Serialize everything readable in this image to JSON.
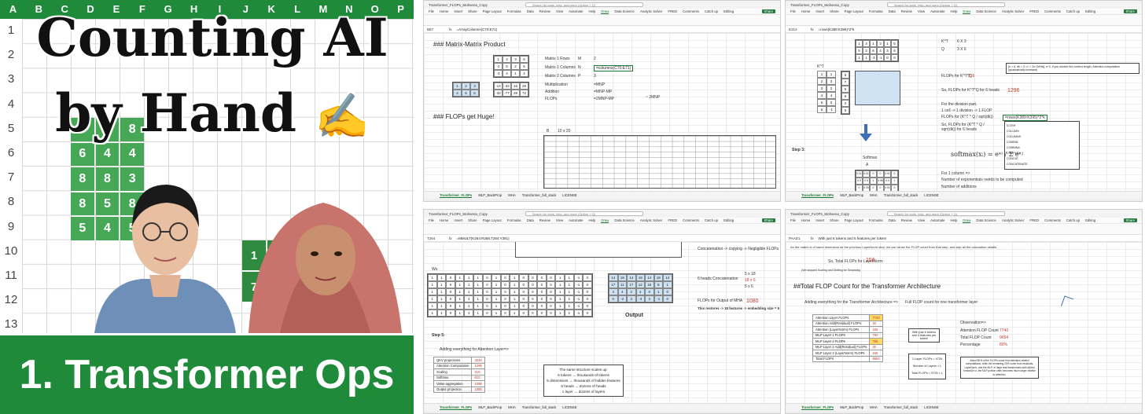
{
  "thumbnail": {
    "col_letters": [
      "A",
      "B",
      "C",
      "D",
      "E",
      "F",
      "G",
      "H",
      "I",
      "J",
      "K",
      "L",
      "M",
      "N",
      "O",
      "P"
    ],
    "row_numbers": [
      "1",
      "2",
      "3",
      "4",
      "5",
      "6",
      "7",
      "8",
      "9",
      "10",
      "11",
      "12",
      "13"
    ],
    "title_line1": "Counting AI",
    "title_line2": "by Hand",
    "hand_emoji": "✍",
    "banner": "1. Transformer Ops",
    "matrix_left": [
      "3",
      "2",
      "8",
      "6",
      "4",
      "4",
      "8",
      "8",
      "3",
      "8",
      "5",
      "8",
      "5",
      "4",
      "5"
    ],
    "matrix_right": [
      "1",
      "",
      "7",
      ""
    ],
    "brand_green": "#1f8a3a"
  },
  "common": {
    "file_title": "Transformer_FLOPs_Mohsena_Copy",
    "search_placeholder": "Search for tools, help, and more (Option + Q)",
    "ribbon": [
      "File",
      "Home",
      "Insert",
      "Share",
      "Page Layout",
      "Formulas",
      "Data",
      "Review",
      "View",
      "Automate",
      "Help",
      "Draw",
      "Data Science",
      "Analytic Solver",
      "FRED"
    ],
    "comments": "Comments",
    "catchup": "Catch up",
    "editing": "Editing",
    "share": "Share",
    "tabs": [
      "Transformer_FLOPs",
      "MLP_BackProp",
      "MHA",
      "Transformer_full_stack",
      "LICENSE"
    ]
  },
  "pane1": {
    "cell": "B67",
    "formula": "=ArrayColumns(C70:E71)",
    "heading1": "### Matrix-Matrix Product",
    "heading2": "### FLOPs get Huge!",
    "matrix_a": [
      "1",
      "4",
      "3",
      "6",
      "-2",
      "5",
      "2",
      "5",
      "-3",
      "4",
      "1",
      "4"
    ],
    "matrix_b": [
      "1",
      "2",
      "3",
      "4",
      "5",
      "6"
    ],
    "result_row1": [
      "-14",
      "-32",
      "16",
      "29"
    ],
    "result_row2": [
      "-32",
      "-77",
      "28",
      "72"
    ],
    "labels": [
      "Matrix 1 Rows",
      "Matrix 1 Columns",
      "Matrix 2 Columns",
      "Multiplication",
      "Addition",
      "FLOPs"
    ],
    "syms": [
      "M",
      "N",
      "P",
      "",
      "",
      ""
    ],
    "vals": [
      "2",
      "=columns(C70:E71)",
      "3",
      "=MNP",
      "=MNP-MP",
      "=2MNP-MP"
    ],
    "note": "~ 2MNP",
    "bxdim": "10 x 20",
    "big_cell_label": "B"
  },
  "pane2": {
    "cell": "E213",
    "formula": "=rows(K389:K395)*2*k",
    "kt_label": "K^T",
    "q_label": "Q",
    "kt_dim": "6 X 3",
    "q_dim": "3 X 6",
    "kt_matrix": [
      "1",
      "3",
      "1",
      "3",
      "1",
      "5",
      "5",
      "3",
      "6",
      "4",
      "3",
      "6",
      "1",
      "1",
      "-3",
      "-1",
      "0",
      "0"
    ],
    "row_labels": [
      "1",
      "2",
      "3",
      "4",
      "5",
      "6"
    ],
    "row_t": [
      "1",
      "3",
      "2",
      "4",
      "0",
      "-1"
    ],
    "kt_side": [
      "5",
      "7",
      "5",
      "6",
      "2",
      "5"
    ],
    "flops_kt": "FLOPs for K^T*Q",
    "flops_kt_val": "216",
    "heads_text": "So, FLOPs for K^T*Q for 6 heads",
    "heads_val": "1296",
    "note": "[n = 6, dk = 3 => = 2n^2d*dk], n^2, if you double the context length, Attention computation (quadratically increase)",
    "divide_title": "For the division part,",
    "divide_line": "1 cell -> 1 division -> 1 FLOP",
    "divide_formula": "FLOPs for (K^T * Q / sqrt(dk))",
    "divide_edit": "=rows(K389:K395)*2*k",
    "heads_div": "So, FLOPs for (K^T * Q / sqrt(dk)) for 6 heads",
    "step": "Step 3:",
    "softmax_label": "Softmax",
    "col_a": "A",
    "softmax_formula": "softmax(xᵢ) = eˣⁱ / Σ eˣʲ",
    "col1": "For 1 column =>",
    "exp_line": "Number of exponentials needs to be computed",
    "add_line": "Number of additions",
    "div_line": "Number of divisions",
    "autocomplete": [
      "ICOSH",
      "COLUMN",
      "COLUMNS",
      "COMBIN",
      "COMBINA",
      "COMPLEX",
      "CONCAT",
      "CONCATENATE"
    ],
    "softmax_vals": [
      "0.01",
      "0.01",
      "0",
      "0",
      "0.01",
      "0",
      "0.9",
      "0.9",
      "1",
      "0.98",
      "0.9",
      "1",
      "0",
      "0.05",
      "0",
      "0",
      "0.01",
      "0",
      "0.06",
      "0.09",
      "0",
      "0.01",
      "0.05",
      "0"
    ]
  },
  "pane3": {
    "cell": "T264",
    "formula": "=MMULT(K264:R268,T264:Y381)",
    "concat": "Concatenation -> copying -> Negligible FLOPs",
    "wo_label": "Wo",
    "heads_concat": "6 heads Concatenation",
    "hc_eq": "=>",
    "hc_dim1": "5 x 18",
    "hc_dim2": "18 x 6",
    "hc_dim3": "5 x 6",
    "flops_mha": "FLOPs for Output of MHA",
    "flops_mha_val": "1080",
    "restore": "This restores -> 18 features -> embedding size = 5",
    "output_label": "Output",
    "step5": "Step 5:",
    "adding": "Adding everything for Attention Layer=>",
    "tbl_rows": [
      [
        "QKV projections",
        "3240"
      ],
      [
        "Attention Computation",
        "1296"
      ],
      [
        "Scaling",
        "216"
      ],
      [
        "Softmax",
        "612"
      ],
      [
        "Value aggregation",
        "1296"
      ],
      [
        "Output projection",
        "1080"
      ]
    ],
    "scale_box_title": "The same structure scales up:",
    "scale_box_lines": [
      "6 tokens → thousands of tokens",
      "5 dimensions → thousands of hidden features",
      "6 heads → dozens of heads",
      "1 layer → dozens of layers"
    ],
    "output_grid": [
      "14",
      "18",
      "14",
      "18",
      "14",
      "18",
      "14",
      "17",
      "11",
      "17",
      "12",
      "15",
      "5",
      "1",
      "4",
      "4",
      "2",
      "2",
      "0",
      "1",
      "0",
      "0",
      "-2",
      "3",
      "-3",
      "3",
      "-1",
      "0"
    ],
    "wo_row": [
      "1",
      "1",
      "0",
      "1",
      "1",
      "1",
      "0",
      "1",
      "0",
      "1",
      "0",
      "0",
      "0",
      "0",
      "1",
      "1",
      "-1",
      "0"
    ]
  },
  "pane4": {
    "cell": "PAAD1",
    "formula": "With just 6 tokens and 5 features per token!",
    "note_line": "As the matrix is of same dimension as the previous LayerNorm step, we can reuse the FLOP count from that step, and skip all the calculation details.",
    "so_total": "So, Total FLOPs for LayerNorm",
    "so_total_val": "156",
    "skip_note": "(We skipped Scaling and Shifting for Simplicity)",
    "heading": "##Total FLOP Count for the Transformer Architecture",
    "adding": "Adding everything for the Transformer Architecture =>",
    "full": "Full FLOP count for one transformer layer",
    "tbl_rows": [
      [
        "Attention Layer FLOPs",
        "7740"
      ],
      [
        "Attention Add(Residual) FLOPs",
        "30"
      ],
      [
        "Attention (LayerNorm) FLOPs",
        "156"
      ],
      [
        "MLP Layer 1 FLOPs",
        "792"
      ],
      [
        "MLP Layer 2 FLOPs",
        "756"
      ],
      [
        "MLP Layer 2 Add(Residual) FLOPs",
        "30"
      ],
      [
        "MLP Layer 2 (LayerNorm) FLOPs",
        "156"
      ],
      [
        "Total FLOPs",
        "9654"
      ]
    ],
    "callout": "With just 6 tokens and 5 features per token!",
    "layer_box": [
      "1 Layer FLOPs = 9726",
      "Number of Layers = L",
      "Total FLOPs = 9726 × L"
    ],
    "obs_title": "Observation=>",
    "obs_rows": [
      [
        "Attention FLOP Count",
        "7740"
      ],
      [
        "Total FLOP Count",
        "9654"
      ],
      [
        "Percentage",
        "80%"
      ]
    ],
    "summary": "About 80% of the FLOPs come from attention-related computations, while the remaining 20% come from residuals, LayerNorm, and the MLP. In large real transformers with d(feed forward)≫d, the MLP portion often becomes much larger relative to attention."
  }
}
